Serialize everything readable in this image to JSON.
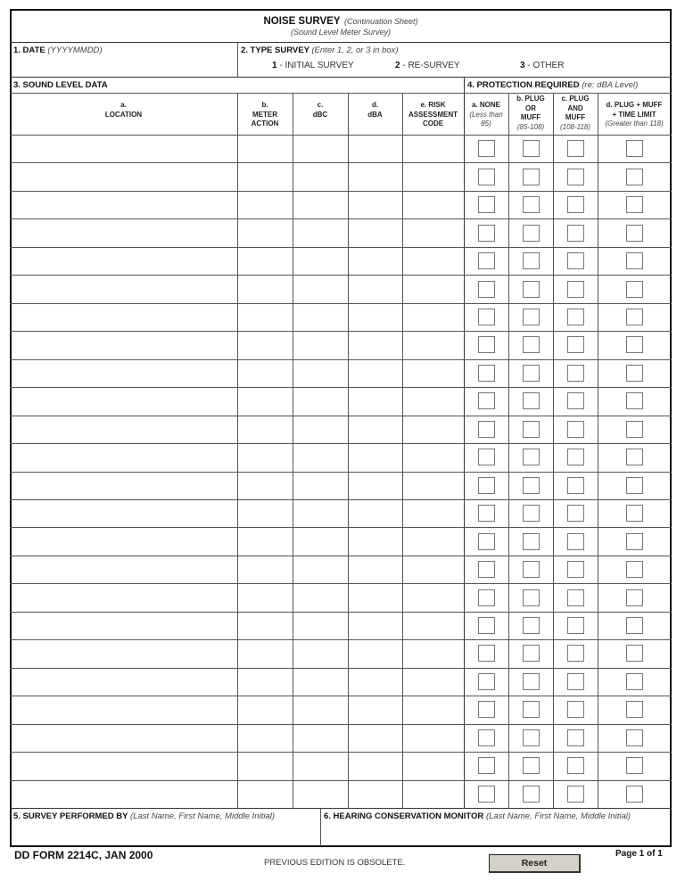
{
  "form": {
    "title": "NOISE SURVEY",
    "title_qualifier": "(Continuation Sheet)",
    "subtitle": "(Sound Level Meter Survey)"
  },
  "section1": {
    "label": "1. DATE",
    "hint": "(YYYYMMDD)",
    "value": ""
  },
  "section2": {
    "label": "2. TYPE SURVEY",
    "hint": "(Enter 1, 2, or 3 in box)",
    "options": [
      {
        "code": "1",
        "text": " - INITIAL SURVEY"
      },
      {
        "code": "2",
        "text": " - RE-SURVEY"
      },
      {
        "code": "3",
        "text": " - OTHER"
      }
    ],
    "value": ""
  },
  "section3": {
    "label": "3. SOUND LEVEL DATA",
    "columns": {
      "location": [
        "a.",
        "LOCATION"
      ],
      "meter_action": [
        "b.",
        "METER",
        "ACTION"
      ],
      "dbc": [
        "c.",
        "dBC"
      ],
      "dba": [
        "d.",
        "dBA"
      ],
      "risk": [
        "e. RISK",
        "ASSESSMENT",
        "CODE"
      ]
    }
  },
  "section4": {
    "label": "4. PROTECTION REQUIRED",
    "hint": "(re: dBA Level)",
    "columns": {
      "none": {
        "lines": [
          "a. NONE"
        ],
        "range": [
          "(Less than",
          "85)"
        ]
      },
      "plug_or_muff": {
        "lines": [
          "b. PLUG",
          "OR",
          "MUFF"
        ],
        "range": [
          "(85-108)"
        ]
      },
      "plug_and_muff": {
        "lines": [
          "c. PLUG",
          "AND",
          "MUFF"
        ],
        "range": [
          "(108-118)"
        ]
      },
      "plug_muff_time": {
        "lines": [
          "d. PLUG + MUFF",
          "+ TIME LIMIT"
        ],
        "range": [
          "(Greater than 118)"
        ]
      }
    }
  },
  "rows": {
    "count": 24,
    "values": []
  },
  "section5": {
    "label": "5. SURVEY PERFORMED BY",
    "hint": "(Last Name, First Name, Middle Initial)",
    "value": ""
  },
  "section6": {
    "label": "6. HEARING CONSERVATION MONITOR",
    "hint": "(Last Name, First Name, Middle Initial)",
    "value": ""
  },
  "footer": {
    "form_id": "DD FORM 2214C, JAN 2000",
    "obsolete_note": "PREVIOUS EDITION IS OBSOLETE.",
    "reset_label": "Reset",
    "page_label": "Page 1 of 1"
  }
}
